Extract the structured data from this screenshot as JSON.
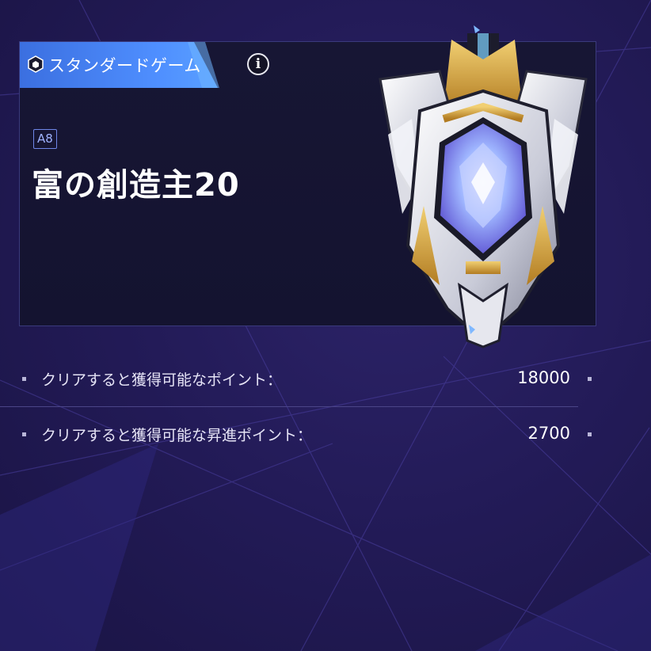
{
  "header": {
    "mode_icon": "hexagon-icon",
    "mode_label": "スタンダードゲーム",
    "info_icon": "info-icon",
    "info_glyph": "i"
  },
  "level": {
    "rank_badge": "A8",
    "title": "富の創造主20"
  },
  "rewards": [
    {
      "label": "クリアすると獲得可能なポイント：",
      "value": "18000"
    },
    {
      "label": "クリアすると獲得可能な昇進ポイント：",
      "value": "2700"
    }
  ],
  "colors": {
    "background": "#221a52",
    "tab_accent": "#4f8fff",
    "card": "#151432",
    "emblem_gold": "#d9a53c",
    "emblem_crystal": "#8fa6ff"
  }
}
